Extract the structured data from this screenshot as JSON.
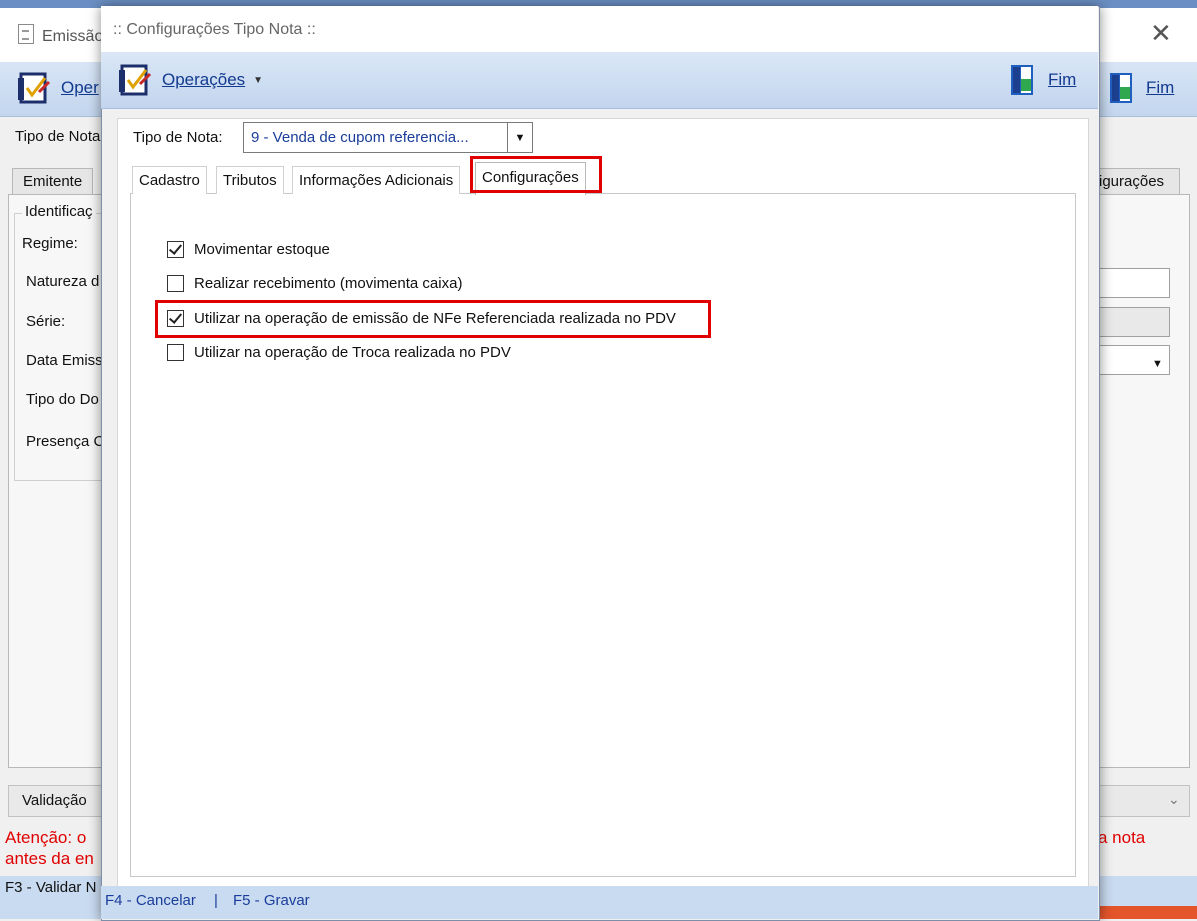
{
  "background_window": {
    "title": "Emissão",
    "toolbar": {
      "operations_label": "Oper",
      "exit_label": "Fim"
    },
    "tipo_nota_label": "Tipo de Nota",
    "tabs": [
      "Emitente",
      "igurações"
    ],
    "group_title": "Identificaç",
    "fields": [
      "Regime:",
      "Natureza d",
      "Série:",
      "Data Emiss",
      "Tipo do Do",
      "Presença C"
    ],
    "validation_label": "Validação",
    "warning_line1": "Atenção: o",
    "warning_line2": "antes da en",
    "warning_right": "a nota",
    "status_text": "F3 - Validar N"
  },
  "dialog": {
    "title": ":: Configurações Tipo Nota ::",
    "toolbar": {
      "operations_label": "Operações",
      "exit_label": "Fim"
    },
    "tipo_nota": {
      "label": "Tipo de Nota:",
      "value": "9 - Venda de cupom referencia..."
    },
    "tabs": [
      {
        "label": "Cadastro"
      },
      {
        "label": "Tributos"
      },
      {
        "label": "Informações Adicionais"
      },
      {
        "label": "Configurações",
        "active": true
      }
    ],
    "options": [
      {
        "label": "Movimentar estoque",
        "checked": true
      },
      {
        "label": "Realizar recebimento (movimenta caixa)",
        "checked": false
      },
      {
        "label": "Utilizar na operação de emissão de NFe Referenciada realizada no PDV",
        "checked": true
      },
      {
        "label": "Utilizar na operação de Troca realizada no PDV",
        "checked": false
      }
    ],
    "status": {
      "cancel": "F4 - Cancelar",
      "separator": "|",
      "save": "F5 - Gravar"
    }
  },
  "colors": {
    "highlight": "#e00000",
    "link": "#123a8f",
    "toolbar": "#c2d5ee",
    "warning": "#e00000"
  },
  "icons": [
    "document-icon",
    "operations-icon",
    "exit-door-icon",
    "close-icon",
    "dropdown-arrow-icon",
    "checkbox-checked-icon"
  ]
}
